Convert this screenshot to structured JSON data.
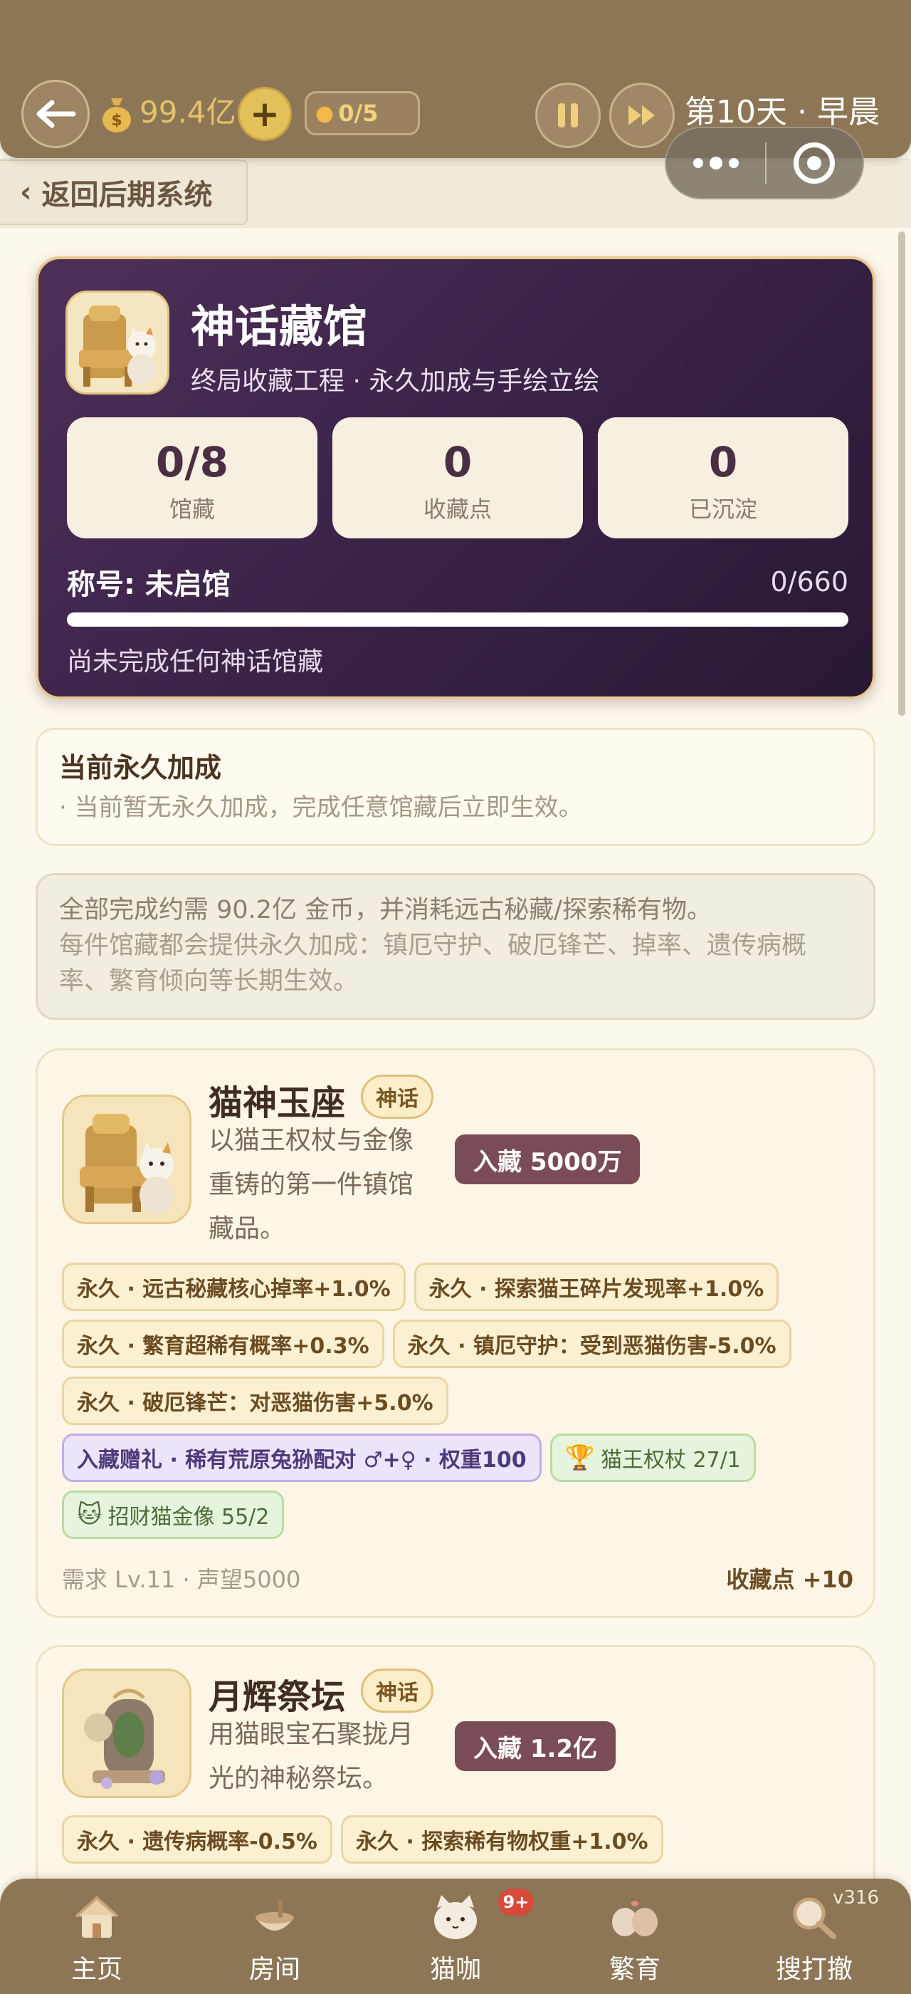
{
  "topbar": {
    "coins": "99.4亿",
    "plus_label": "+",
    "cat_count": "0/5",
    "day": "第10天 · 早晨"
  },
  "nav": {
    "back_label": "返回后期系统"
  },
  "museum": {
    "title": "神话藏馆",
    "subtitle": "终局收藏工程 · 永久加成与手绘立绘",
    "stats": [
      {
        "value": "0/8",
        "label": "馆藏"
      },
      {
        "value": "0",
        "label": "收藏点"
      },
      {
        "value": "0",
        "label": "已沉淀"
      }
    ],
    "title_label": "称号: 未启馆",
    "progress_text": "0/660",
    "progress": 0,
    "note": "尚未完成任何神话馆藏"
  },
  "bonus": {
    "heading": "当前永久加成",
    "text": "· 当前暂无永久加成，完成任意馆藏后立即生效。"
  },
  "info": {
    "line1": "全部完成约需 90.2亿 金币，并消耗远古秘藏/探索稀有物。",
    "line2": "每件馆藏都会提供永久加成：镇厄守护、破厄锋芒、掉率、遗传病概率、繁育倾向等长期生效。"
  },
  "items": [
    {
      "name": "猫神玉座",
      "tag": "神话",
      "desc": "以猫王权杖与金像重铸的第一件镇馆藏品。",
      "cost": "入藏 5000万",
      "effects": [
        "永久 · 远古秘藏核心掉率+1.0%",
        "永久 · 探索猫王碎片发现率+1.0%",
        "永久 · 繁育超稀有概率+0.3%",
        "永久 · 镇厄守护：受到恶猫伤害-5.0%",
        "永久 · 破厄锋芒：对恶猫伤害+5.0%"
      ],
      "gift": "入藏赠礼 · 稀有荒原兔狲配对 ♂+♀ · 权重100",
      "materials": [
        "猫王权杖 27/1",
        "招财猫金像 55/2"
      ],
      "requirement": "需求 Lv.11 · 声望5000",
      "points": "收藏点 +10"
    },
    {
      "name": "月辉祭坛",
      "tag": "神话",
      "desc": "用猫眼宝石聚拢月光的神秘祭坛。",
      "cost": "入藏 1.2亿",
      "effects": [
        "永久 · 遗传病概率-0.5%",
        "永久 · 探索稀有物权重+1.0%"
      ]
    }
  ],
  "bottom_nav": {
    "items": [
      "主页",
      "房间",
      "猫咖",
      "繁育",
      "搜打撤"
    ],
    "badge": "9+",
    "version": "v316"
  },
  "colors": {
    "bar": "#8d7655",
    "museum_bg": "#3c2449",
    "accent_gold": "#e3c15a",
    "cost_badge": "#7a4c56"
  }
}
